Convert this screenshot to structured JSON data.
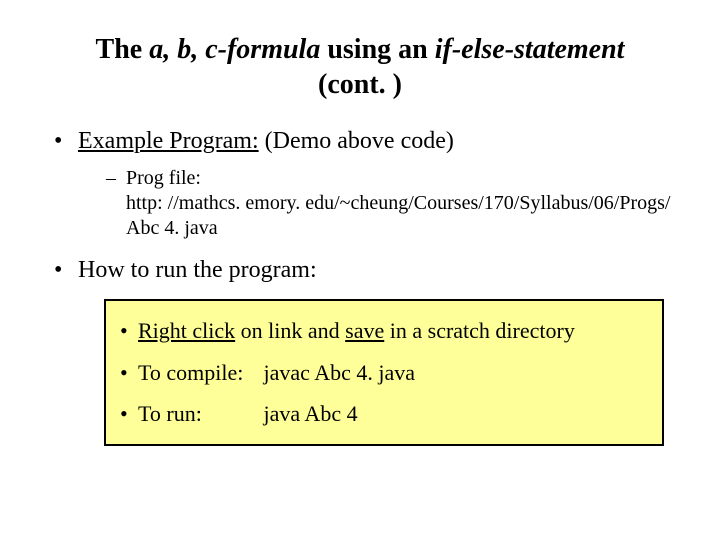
{
  "title": {
    "prefix": "The ",
    "italic1": "a, b, c-formula",
    "mid": " using an ",
    "italic2": "if-else-statement",
    "line2": "(cont. )"
  },
  "bullets": {
    "example": {
      "underlined": "Example Program:",
      "rest": " (Demo above code)"
    },
    "prog": {
      "label": "Prog file:",
      "url": "http: //mathcs. emory. edu/~cheung/Courses/170/Syllabus/06/Progs/ Abc 4. java"
    },
    "howto": "How to run the program:"
  },
  "box": {
    "row1": {
      "a": "Right click",
      "b": " on link and ",
      "c": "save",
      "d": " in a scratch directory"
    },
    "row2": {
      "label": "To compile:",
      "cmd": "javac Abc 4. java"
    },
    "row3": {
      "label": "To run:",
      "cmd": "java Abc 4"
    }
  }
}
